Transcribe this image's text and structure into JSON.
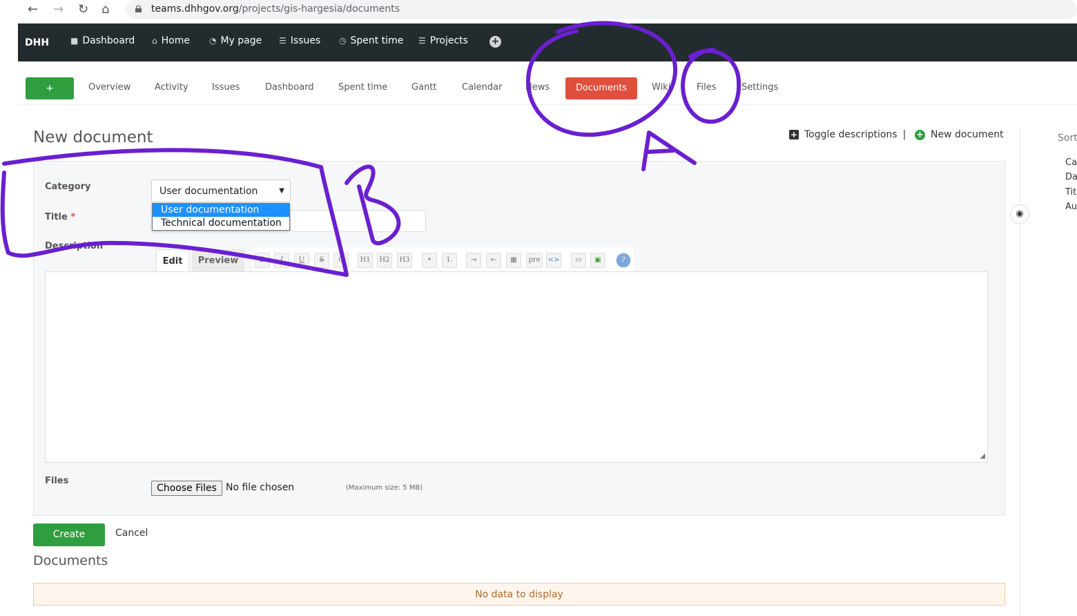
{
  "browser": {
    "url_host": "teams.dhhgov.org",
    "url_path": "/projects/gis-hargesia/documents"
  },
  "topbar": {
    "brand": "DHH",
    "items": [
      {
        "label": "Dashboard",
        "icon": "square-icon"
      },
      {
        "label": "Home",
        "icon": "home-icon"
      },
      {
        "label": "My page",
        "icon": "gauge-icon"
      },
      {
        "label": "Issues",
        "icon": "list-icon"
      },
      {
        "label": "Spent time",
        "icon": "clock-icon"
      },
      {
        "label": "Projects",
        "icon": "list-icon"
      }
    ],
    "plus_icon": "+"
  },
  "project_menu": {
    "add_label": "+",
    "tabs": [
      "Overview",
      "Activity",
      "Issues",
      "Dashboard",
      "Spent time",
      "Gantt",
      "Calendar",
      "News",
      "Documents",
      "Wiki",
      "Files",
      "Settings"
    ],
    "active": "Documents"
  },
  "page": {
    "title": "New document",
    "toggle_descriptions": "Toggle descriptions",
    "separator": "|",
    "new_document": "New document"
  },
  "form": {
    "category_label": "Category",
    "category_value": "User documentation",
    "category_options": [
      "User documentation",
      "Technical documentation"
    ],
    "title_label": "Title",
    "required_mark": "*",
    "description_label": "Description",
    "edit_tab": "Edit",
    "preview_tab": "Preview",
    "toolbar": [
      "B",
      "I",
      "U",
      "S",
      "C",
      "H1",
      "H2",
      "H3",
      "•",
      "1.",
      "⇥",
      "⇤",
      "▦",
      "pre",
      "<>",
      "▭",
      "▣",
      "?"
    ],
    "files_label": "Files",
    "choose_files": "Choose Files",
    "no_file": "No file chosen",
    "max_size": "(Maximum size: 5 MB)",
    "create": "Create",
    "cancel": "Cancel"
  },
  "documents": {
    "title": "Documents",
    "empty": "No data to display"
  },
  "sidebar": {
    "sort_heading": "Sort",
    "items": [
      "Ca",
      "Da",
      "Titl",
      "Au"
    ]
  },
  "annotations": {
    "letter_a": "A",
    "letter_b": "B",
    "color": "#6a1fd0"
  },
  "colors": {
    "topbar_bg": "#222b2e",
    "accent_green": "#2e9e3e",
    "active_tab": "#e04e3c"
  }
}
